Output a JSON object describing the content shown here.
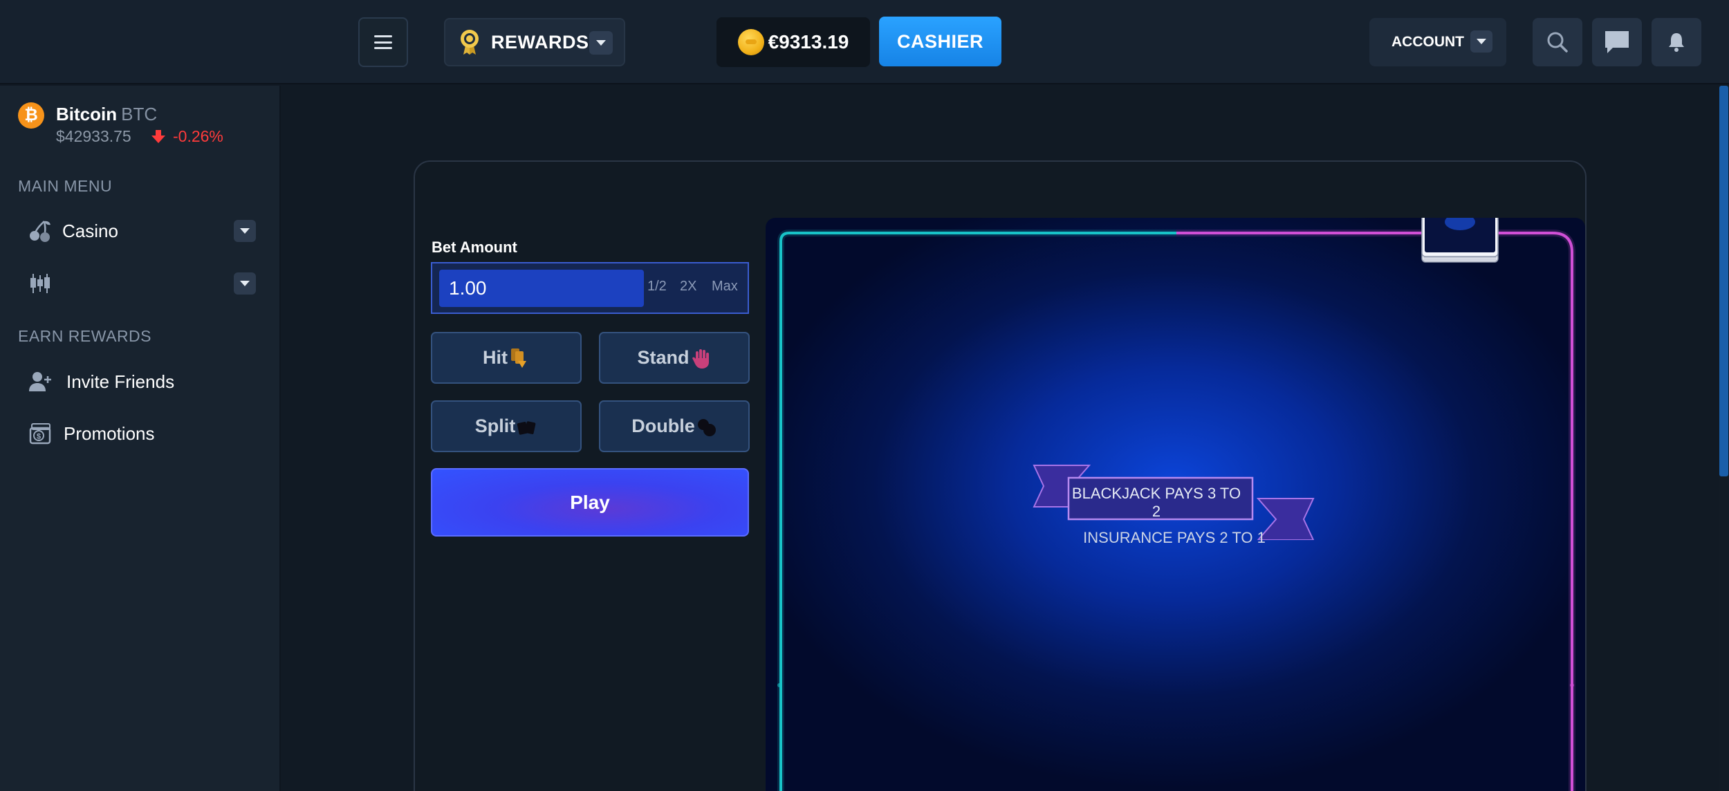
{
  "header": {
    "rewards_label": "REWARDS",
    "balance": "€9313.19",
    "cashier_label": "CASHIER",
    "account_label": "ACCOUNT",
    "icons": [
      "menu-icon",
      "medal-icon",
      "coin-icon",
      "search-icon",
      "chat-icon",
      "bell-icon"
    ]
  },
  "sidebar": {
    "crypto": {
      "name": "Bitcoin",
      "ticker": "BTC",
      "price": "$42933.75",
      "change": "-0.26%",
      "change_color": "#ff3b3b"
    },
    "main_menu_title": "MAIN MENU",
    "main_menu": [
      {
        "label": "Casino",
        "icon": "cherries-icon"
      },
      {
        "label": "",
        "icon": "candlestick-icon"
      }
    ],
    "earn_title": "EARN REWARDS",
    "earn_items": [
      {
        "label": "Invite Friends",
        "icon": "add-user-icon"
      },
      {
        "label": "Promotions",
        "icon": "money-icon"
      }
    ]
  },
  "game": {
    "bet_label": "Bet Amount",
    "bet_value": "1.00",
    "half_label": "1/2",
    "double_label": "2X",
    "max_label": "Max",
    "hit_label": "Hit",
    "stand_label": "Stand",
    "split_label": "Split",
    "double_down_label": "Double",
    "play_label": "Play",
    "banner_text": "BLACKJACK PAYS 3 TO 2",
    "insurance_text": "INSURANCE PAYS 2 TO 1"
  },
  "colors": {
    "accent_blue": "#2aa2ff",
    "play_blue": "#3353ff",
    "table_neon_cyan": "#18c3c8",
    "table_neon_magenta": "#d04fd6"
  }
}
